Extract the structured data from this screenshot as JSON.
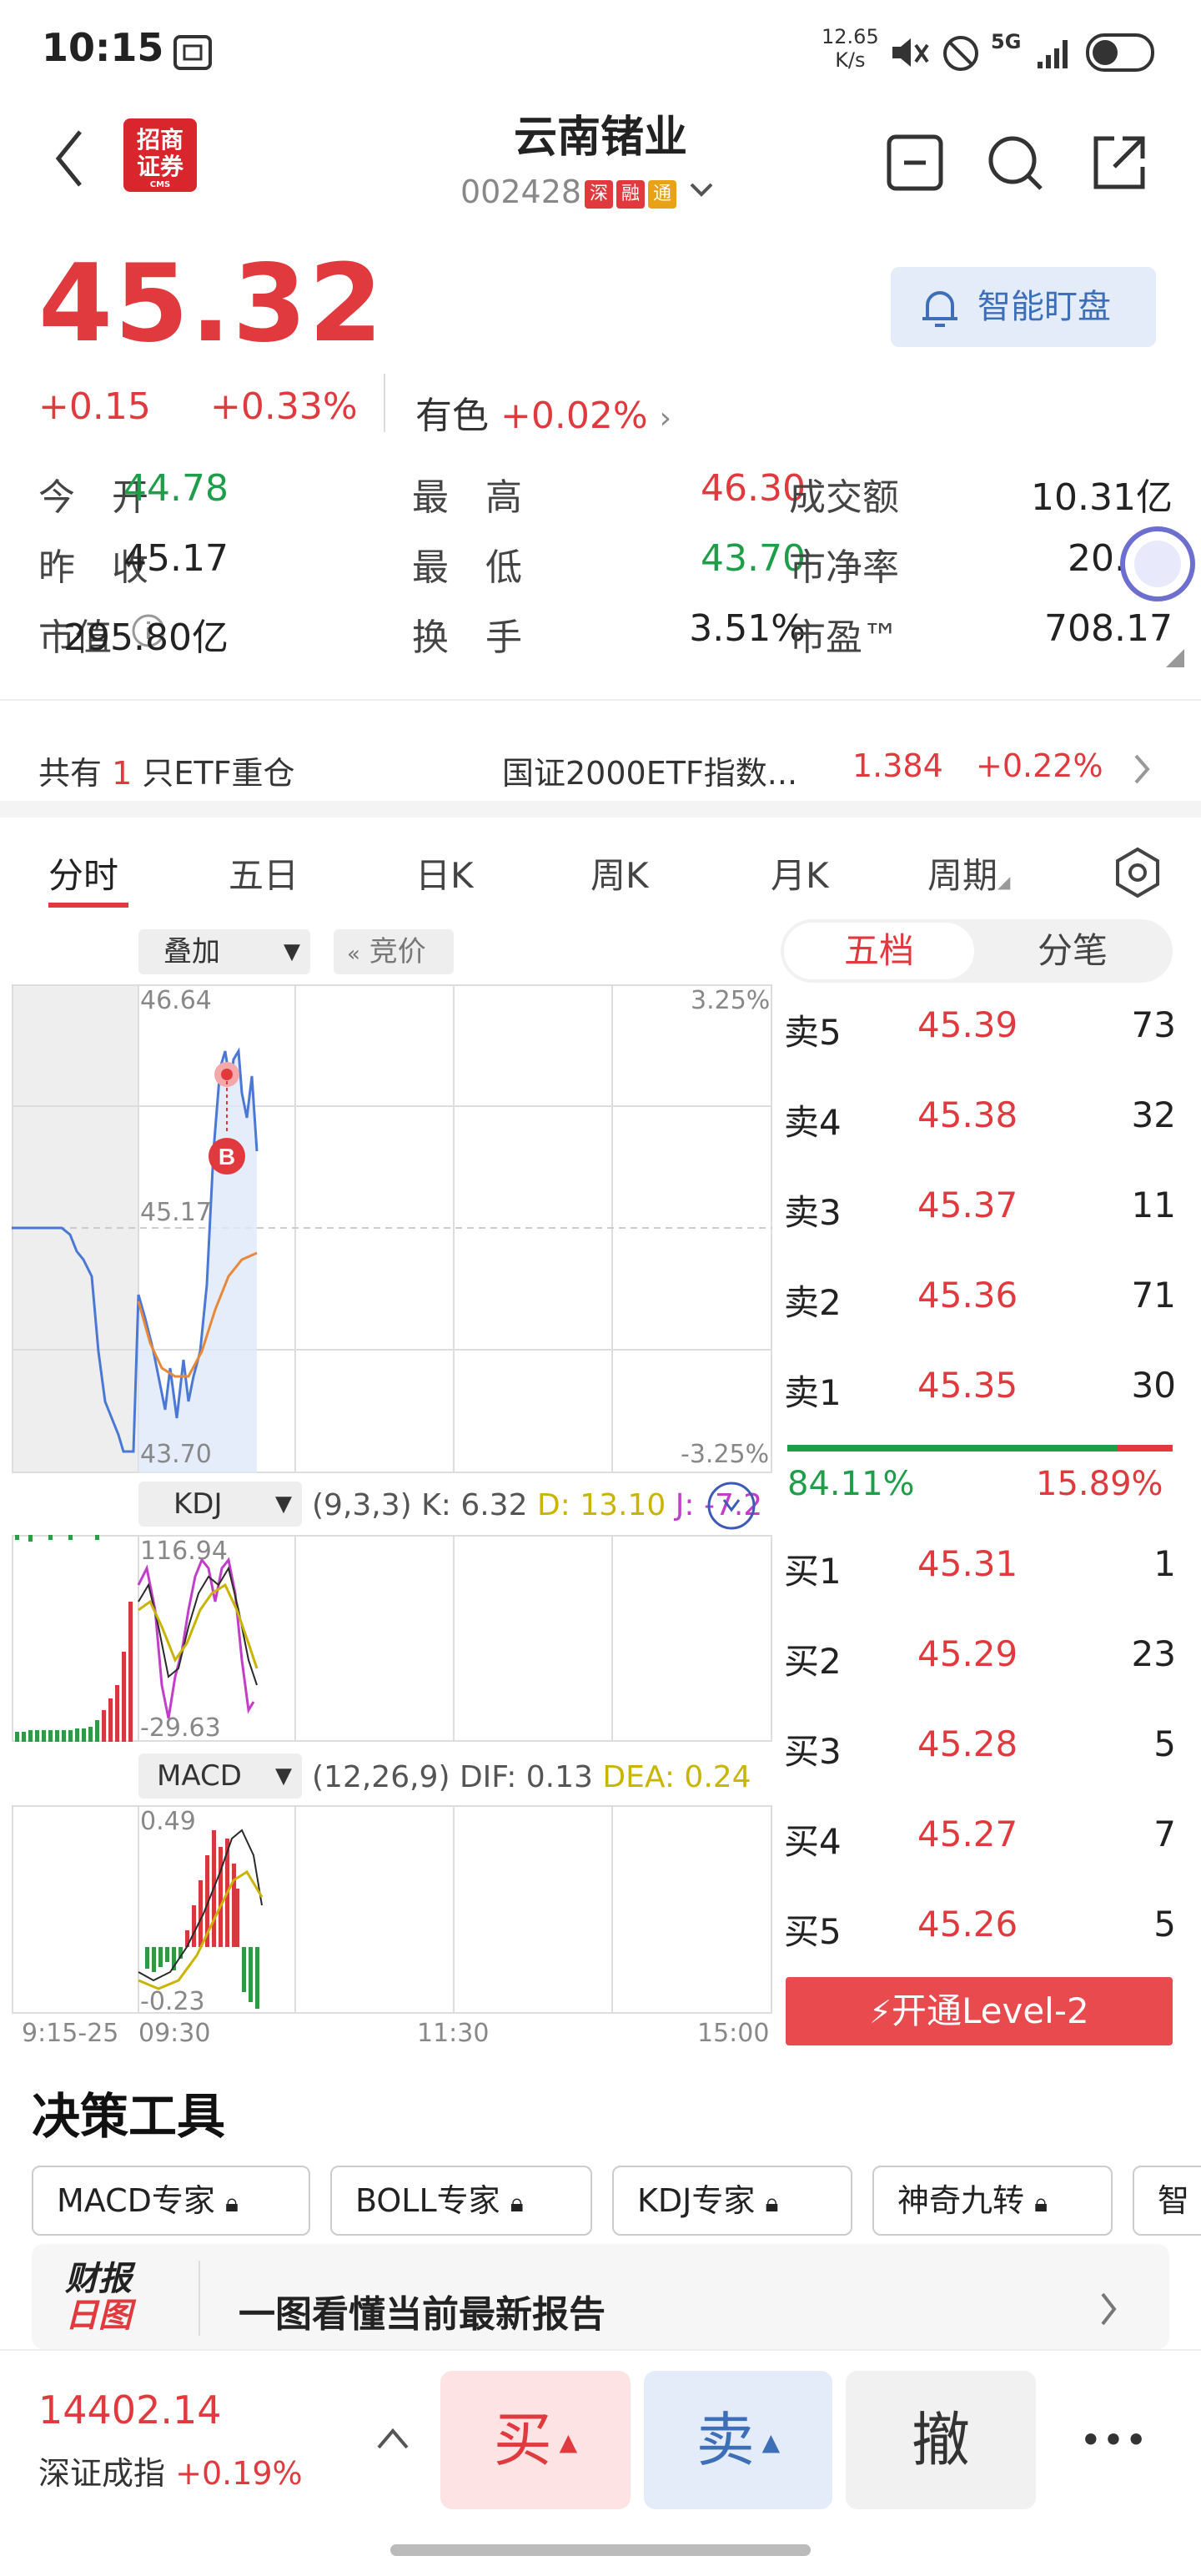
{
  "status_bar": {
    "time": "10:15",
    "net_speed": "12.65",
    "net_unit": "K/s",
    "signal": "5G"
  },
  "header": {
    "broker_logo": "招商证券",
    "broker_logo_small": "CMS",
    "title": "云南锗业",
    "code": "002428",
    "tags": [
      {
        "text": "深",
        "color": "#e03a3e"
      },
      {
        "text": "融",
        "color": "#e03a3e"
      },
      {
        "text": "通",
        "color": "#e8a21a"
      }
    ]
  },
  "quote": {
    "price": "45.32",
    "change": "+0.15",
    "change_pct": "+0.33%",
    "sector": "有色",
    "sector_pct": "+0.02%",
    "smart_watch": "智能盯盘"
  },
  "stats": [
    [
      {
        "label": "今　开",
        "value": "44.78",
        "color": "green"
      },
      {
        "label": "最　高",
        "value": "46.30",
        "color": "red"
      },
      {
        "label": "成交额",
        "value": "10.31亿",
        "color": ""
      }
    ],
    [
      {
        "label": "昨　收",
        "value": "45.17",
        "color": ""
      },
      {
        "label": "最　低",
        "value": "43.70",
        "color": "green"
      },
      {
        "label": "市净率",
        "value": "20.34",
        "color": ""
      }
    ],
    [
      {
        "label": "市值",
        "value": "295.80亿",
        "color": ""
      },
      {
        "label": "换　手",
        "value": "3.51%",
        "color": ""
      },
      {
        "label": "市盈™",
        "value": "708.17",
        "color": ""
      }
    ]
  ],
  "etf": {
    "prefix": "共有",
    "count": "1",
    "suffix": "只ETF重仓",
    "name": "国证2000ETF指数...",
    "price": "1.384",
    "pct": "+0.22%"
  },
  "tabs": [
    "分时",
    "五日",
    "日K",
    "周K",
    "月K",
    "周期"
  ],
  "chart": {
    "overlay": "叠加",
    "auction": "竞价",
    "price_high": "46.64",
    "price_mid": "45.17",
    "price_low": "43.70",
    "pct_high": "3.25%",
    "pct_low": "-3.25%",
    "buy_marker": "B",
    "kdj": {
      "name": "KDJ",
      "params": "(9,3,3)",
      "k": "K: 6.32",
      "d": "D: 13.10",
      "j": "J: -7.2",
      "high": "116.94",
      "low": "-29.63"
    },
    "macd": {
      "name": "MACD",
      "params": "(12,26,9)",
      "dif": "DIF: 0.13",
      "dea": "DEA: 0.24",
      "high": "0.49",
      "low": "-0.23"
    },
    "times": [
      "9:15-25",
      "09:30",
      "11:30",
      "15:00"
    ]
  },
  "orderbook": {
    "tabs": [
      "五档",
      "分笔"
    ],
    "asks": [
      {
        "label": "卖5",
        "price": "45.39",
        "vol": "73"
      },
      {
        "label": "卖4",
        "price": "45.38",
        "vol": "32"
      },
      {
        "label": "卖3",
        "price": "45.37",
        "vol": "11"
      },
      {
        "label": "卖2",
        "price": "45.36",
        "vol": "71"
      },
      {
        "label": "卖1",
        "price": "45.35",
        "vol": "30"
      }
    ],
    "buy_ratio": "84.11%",
    "sell_ratio": "15.89%",
    "bids": [
      {
        "label": "买1",
        "price": "45.31",
        "vol": "1"
      },
      {
        "label": "买2",
        "price": "45.29",
        "vol": "23"
      },
      {
        "label": "买3",
        "price": "45.28",
        "vol": "5"
      },
      {
        "label": "买4",
        "price": "45.27",
        "vol": "7"
      },
      {
        "label": "买5",
        "price": "45.26",
        "vol": "5"
      }
    ],
    "level2": "开通Level-2"
  },
  "tools": {
    "title": "决策工具",
    "chips": [
      "MACD专家",
      "BOLL专家",
      "KDJ专家",
      "神奇九转",
      "智"
    ],
    "report_logo_1": "财报",
    "report_logo_2": "日图",
    "report_text": "一图看懂当前最新报告"
  },
  "bottom_bar": {
    "index_value": "14402.14",
    "index_name": "深证成指",
    "index_pct": "+0.19%",
    "buy": "买",
    "sell": "卖",
    "cancel": "撤",
    "more": "•••"
  }
}
